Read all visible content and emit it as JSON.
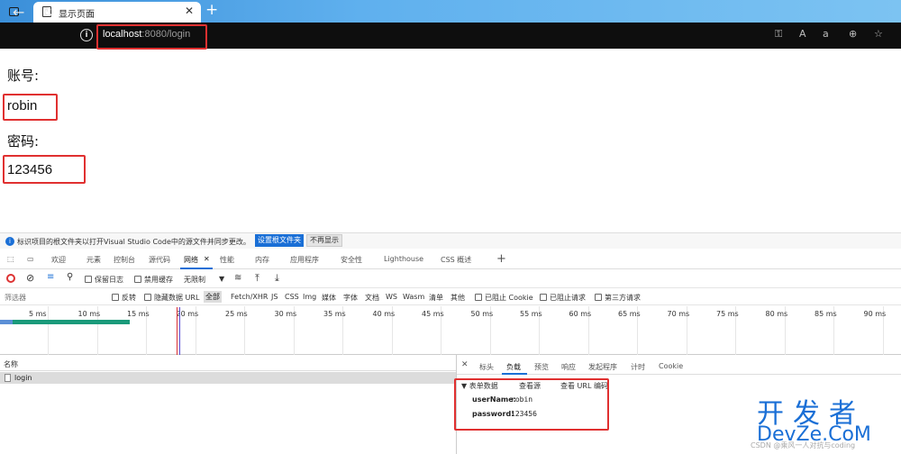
{
  "browser": {
    "tab_title": "显示页面",
    "tab_close": "✕",
    "new_tab": "+",
    "address_host": "localhost",
    "address_rest": ":8080/login",
    "back": "←",
    "reload": "↻"
  },
  "page": {
    "account_label": "账号:",
    "account_value": "robin",
    "password_label": "密码:",
    "password_value": "123456"
  },
  "devtools": {
    "notice": "标识项目的根文件夹以打开Visual Studio Code中的源文件并同步更改。",
    "set_root_button": "设置根文件夹",
    "dont_show_button": "不再显示",
    "tabs": [
      "欢迎",
      "元素",
      "控制台",
      "源代码",
      "网络",
      "性能",
      "内存",
      "应用程序",
      "安全性",
      "Lighthouse",
      "CSS 概述"
    ],
    "network_tab_close": "✕",
    "toolbar": {
      "preserve_log": "保留日志",
      "disable_cache": "禁用缓存",
      "throttle": "无限制"
    },
    "filter": {
      "placeholder": "筛选器",
      "invert": "反转",
      "hide_data_url": "隐藏数据 URL",
      "all": "全部",
      "types": [
        "Fetch/XHR",
        "JS",
        "CSS",
        "Img",
        "媒体",
        "字体",
        "文档",
        "WS",
        "Wasm",
        "清单",
        "其他"
      ],
      "blocked_cookie": "已阻止 Cookie",
      "blocked_requests": "已阻止请求",
      "third_party": "第三方请求"
    },
    "timeline_ticks": [
      "5 ms",
      "10 ms",
      "15 ms",
      "20 ms",
      "25 ms",
      "30 ms",
      "35 ms",
      "40 ms",
      "45 ms",
      "50 ms",
      "55 ms",
      "60 ms",
      "65 ms",
      "70 ms",
      "75 ms",
      "80 ms",
      "85 ms",
      "90 ms"
    ],
    "name_header": "名称",
    "request_name": "login",
    "detail_close": "✕",
    "detail_tabs": [
      "标头",
      "负载",
      "预览",
      "响应",
      "发起程序",
      "计时",
      "Cookie"
    ],
    "payload": {
      "section": "▼ 表单数据",
      "view_source": "查看源",
      "view_url_encoded": "查看 URL 编码",
      "fields": [
        {
          "key": "userName:",
          "value": "robin"
        },
        {
          "key": "password:",
          "value": "123456"
        }
      ]
    }
  },
  "watermark": {
    "line1": "开发者",
    "line2": "DevZe.CoM",
    "credit": "CSDN @乘风一人对抗与coding"
  },
  "colors": {
    "highlight_red": "#e03030",
    "accent_blue": "#1a6fd6"
  }
}
